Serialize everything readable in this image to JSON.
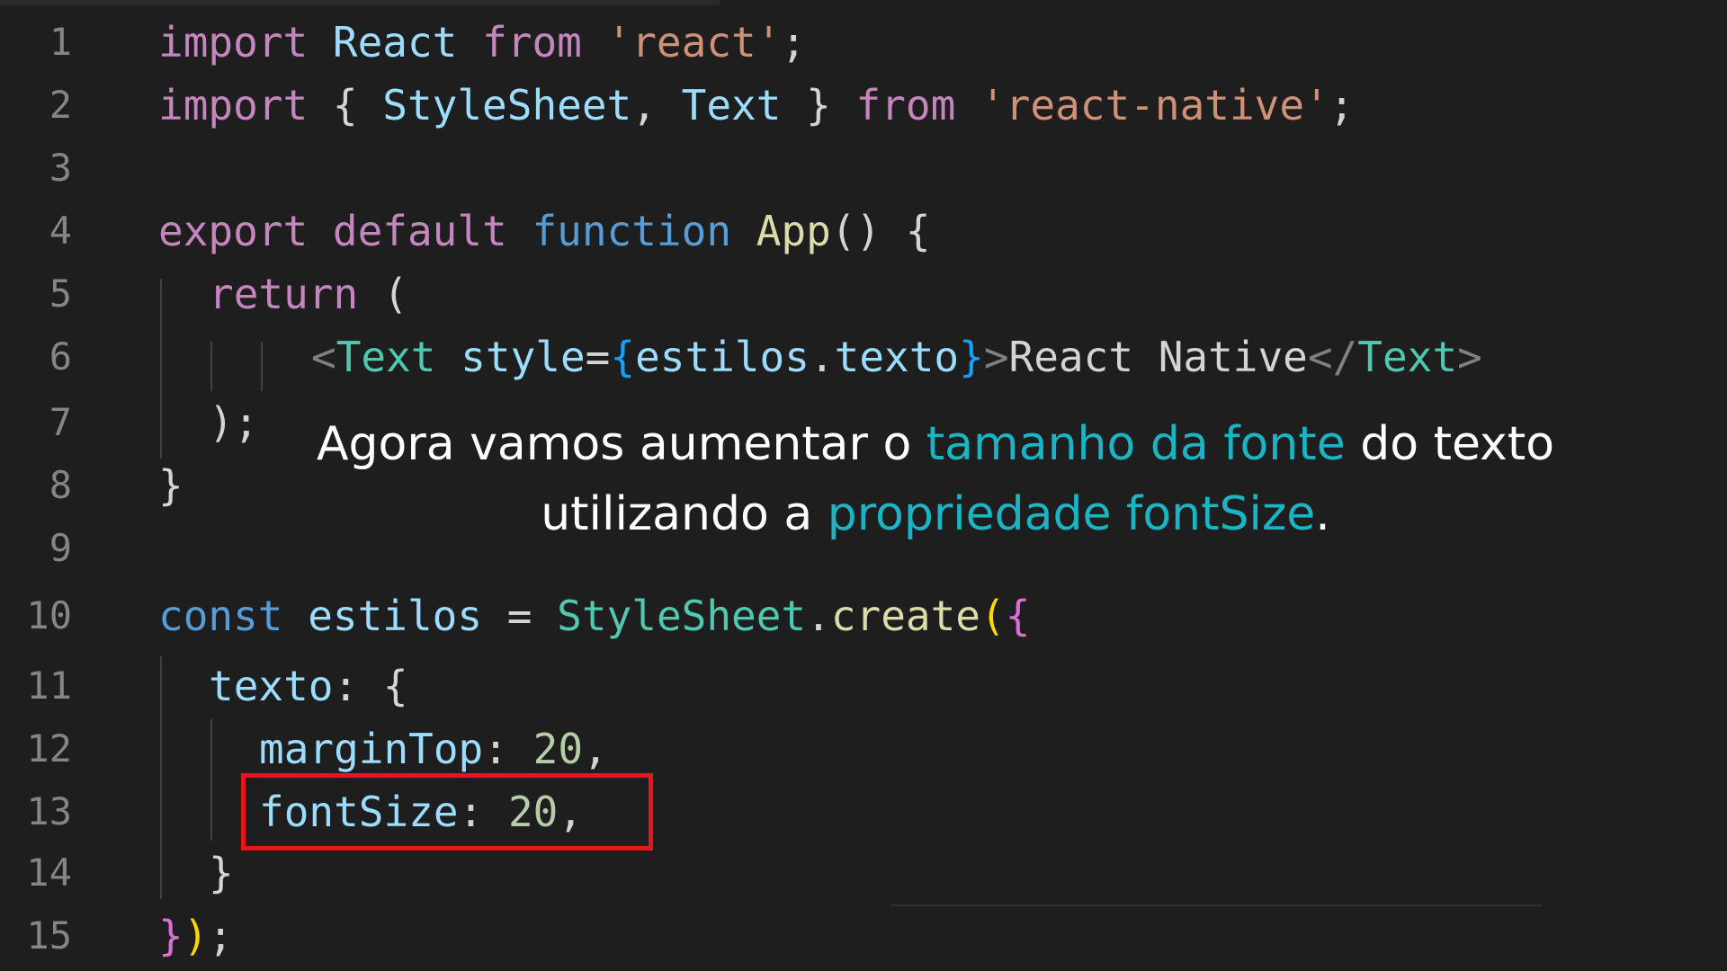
{
  "editor": {
    "line_numbers": [
      "1",
      "2",
      "3",
      "4",
      "5",
      "6",
      "7",
      "8",
      "9",
      "10",
      "11",
      "12",
      "13",
      "14",
      "15"
    ],
    "code": {
      "l1": {
        "import": "import",
        "react": "React",
        "from": "from",
        "str": "'react'",
        "semi": ";"
      },
      "l2": {
        "import": "import",
        "ob": "{",
        "stylesheet": "StyleSheet",
        "comma": ",",
        "text": "Text",
        "cb": "}",
        "from": "from",
        "str": "'react-native'",
        "semi": ";"
      },
      "l4": {
        "export": "export",
        "default": "default",
        "function": "function",
        "app": "App",
        "parens": "()",
        "ob": "{"
      },
      "l5": {
        "return": "return",
        "paren": "("
      },
      "l6": {
        "lt": "<",
        "text": "Text",
        "style": "style",
        "eq": "=",
        "ob": "{",
        "estilos": "estilos",
        "dot": ".",
        "texto": "texto",
        "cb": "}",
        "gt": ">",
        "content": "React Native",
        "close_lt": "</",
        "close_text": "Text",
        "close_gt": ">"
      },
      "l7": {
        "close": ");"
      },
      "l8": {
        "cb": "}"
      },
      "l10": {
        "const": "const",
        "estilos": "estilos",
        "eq": "=",
        "stylesheet": "StyleSheet",
        "dot": ".",
        "create": "create",
        "op": "(",
        "ob": "{"
      },
      "l11": {
        "key": "texto",
        "colon": ":",
        "ob": "{"
      },
      "l12": {
        "key": "marginTop",
        "colon": ":",
        "value": "20",
        "comma": ","
      },
      "l13": {
        "key": "fontSize",
        "colon": ":",
        "value": "20",
        "comma": ","
      },
      "l14": {
        "cb": "}"
      },
      "l15": {
        "cb": "}",
        "cp": ")",
        "semi": ";"
      }
    }
  },
  "caption": {
    "part1": "Agora vamos aumentar o ",
    "highlight1": "tamanho da fonte",
    "part2": " do texto utilizando a ",
    "highlight2": "propriedade fontSize",
    "part3": "."
  },
  "colors": {
    "background": "#1e1e1e",
    "caption_highlight": "#1ab4c5",
    "box_border": "#e8141b"
  }
}
